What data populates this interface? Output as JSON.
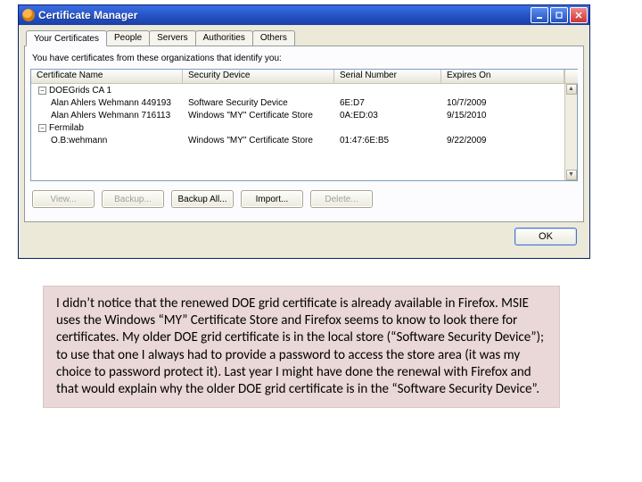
{
  "window": {
    "title": "Certificate Manager"
  },
  "tabs": [
    {
      "label": "Your Certificates",
      "active": true
    },
    {
      "label": "People"
    },
    {
      "label": "Servers"
    },
    {
      "label": "Authorities"
    },
    {
      "label": "Others"
    }
  ],
  "panel": {
    "caption": "You have certificates from these organizations that identify you:",
    "columns": {
      "name": "Certificate Name",
      "device": "Security Device",
      "serial": "Serial Number",
      "expires": "Expires On",
      "extra": " "
    }
  },
  "groups": [
    {
      "label": "DOEGrids CA 1",
      "expanded": true,
      "rows": [
        {
          "name": "Alan Ahlers Wehmann 449193",
          "device": "Software Security Device",
          "serial": "6E:D7",
          "expires": "10/7/2009"
        },
        {
          "name": "Alan Ahlers Wehmann 716113",
          "device": "Windows \"MY\" Certificate Store",
          "serial": "0A:ED:03",
          "expires": "9/15/2010"
        }
      ]
    },
    {
      "label": "Fermilab",
      "expanded": true,
      "rows": [
        {
          "name": "O.B:wehmann",
          "device": "Windows \"MY\" Certificate Store",
          "serial": "01:47:6E:B5",
          "expires": "9/22/2009"
        }
      ]
    }
  ],
  "buttons": {
    "view": "View...",
    "backup": "Backup...",
    "backup_all": "Backup All...",
    "import": "Import...",
    "delete": "Delete...",
    "ok": "OK"
  },
  "note": "I didn’t notice that the renewed DOE grid certificate is already available in Firefox.  MSIE uses the Windows “MY” Certificate Store and Firefox seems to know to look there for certificates.  My older DOE grid certificate is in the local store (“Software Security Device”); to use that one I always had to provide a password to access the store area (it was my choice to password protect it).  Last year I might have done the renewal with Firefox and that would explain why the older DOE grid certificate is in the “Software Security Device”."
}
